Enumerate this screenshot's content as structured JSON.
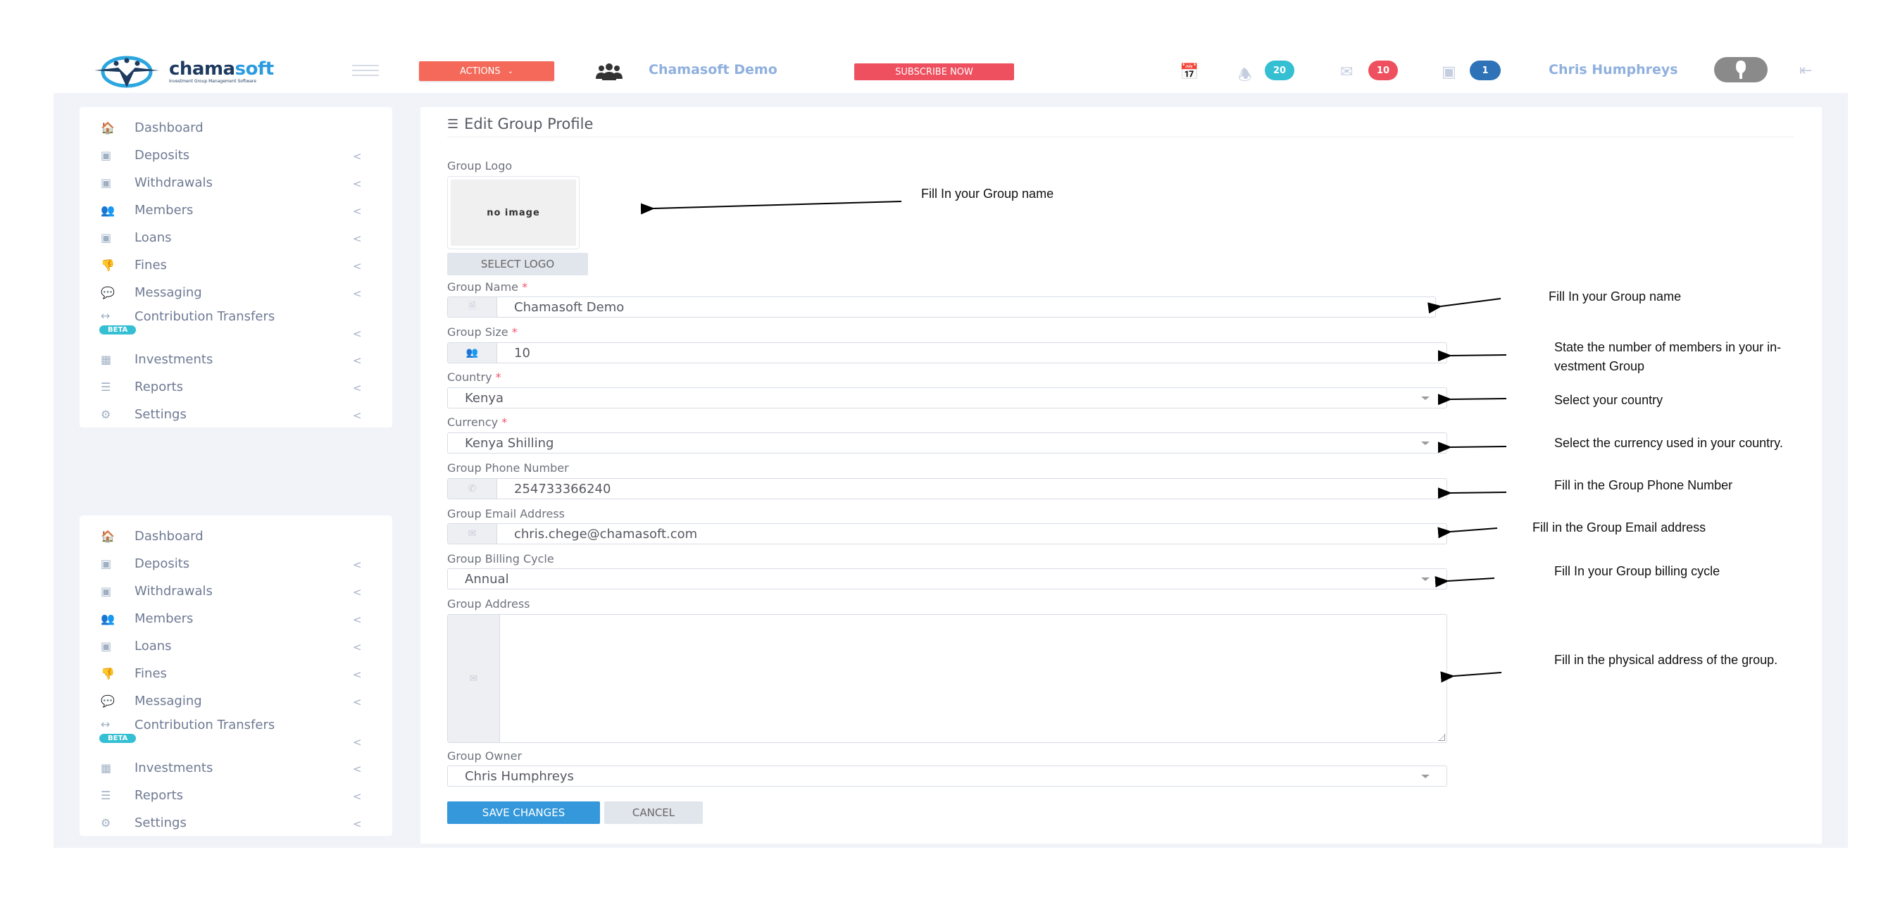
{
  "header": {
    "logo_primary": "chama",
    "logo_secondary": "soft",
    "logo_tagline": "Investment Group Management Software",
    "actions_label": "ACTIONS",
    "group_name": "Chamasoft Demo",
    "subscribe_label": "SUBSCRIBE NOW",
    "notifications_count": "20",
    "messages_count": "10",
    "payments_count": "1",
    "user_name": "Chris Humphreys",
    "colors": {
      "actions": "#f4695a",
      "subscribe": "#ee505f",
      "notifications_badge": "#34bfd3",
      "messages_badge": "#ee505f",
      "payments_badge": "#2e73b8",
      "link": "#8fb0de"
    }
  },
  "sidebar": {
    "items": [
      {
        "label": "Dashboard",
        "icon": "home-icon",
        "expandable": false
      },
      {
        "label": "Deposits",
        "icon": "money-icon",
        "expandable": true
      },
      {
        "label": "Withdrawals",
        "icon": "money-icon",
        "expandable": true
      },
      {
        "label": "Members",
        "icon": "users-icon",
        "expandable": true
      },
      {
        "label": "Loans",
        "icon": "money-icon",
        "expandable": true
      },
      {
        "label": "Fines",
        "icon": "thumbs-down-icon",
        "expandable": true
      },
      {
        "label": "Messaging",
        "icon": "chat-icon",
        "expandable": true
      },
      {
        "label": "Contribution Transfers",
        "icon": "arrows-horizontal-icon",
        "expandable": true,
        "badge": "BETA"
      },
      {
        "label": "Investments",
        "icon": "building-icon",
        "expandable": true
      },
      {
        "label": "Reports",
        "icon": "bars-icon",
        "expandable": true
      },
      {
        "label": "Settings",
        "icon": "gears-icon",
        "expandable": true
      }
    ]
  },
  "form": {
    "title": "Edit Group Profile",
    "logo_label": "Group Logo",
    "logo_placeholder": "no image",
    "select_logo_label": "SELECT LOGO",
    "group_name_label": "Group Name",
    "group_name_value": "Chamasoft Demo",
    "group_size_label": "Group Size",
    "group_size_value": "10",
    "country_label": "Country",
    "country_value": "Kenya",
    "currency_label": "Currency",
    "currency_value": "Kenya Shilling",
    "phone_label": "Group Phone Number",
    "phone_value": "254733366240",
    "email_label": "Group Email Address",
    "email_value": "chris.chege@chamasoft.com",
    "billing_label": "Group Billing Cycle",
    "billing_value": "Annual",
    "address_label": "Group Address",
    "address_value": "",
    "owner_label": "Group Owner",
    "owner_value": "Chris Humphreys",
    "required_mark": "*",
    "save_label": "SAVE CHANGES",
    "cancel_label": "CANCEL"
  },
  "annotations": {
    "logo": "Fill In your Group name",
    "group_name": "Fill In your Group name",
    "group_size": "State the number of members in your in- vestment Group",
    "country": "Select your country",
    "currency": "Select the currency used in your country.",
    "phone": "Fill in the Group Phone Number",
    "email": "Fill in the Group Email address",
    "billing": "Fill In your Group billing  cycle",
    "address": "Fill in the physical address of the group."
  }
}
